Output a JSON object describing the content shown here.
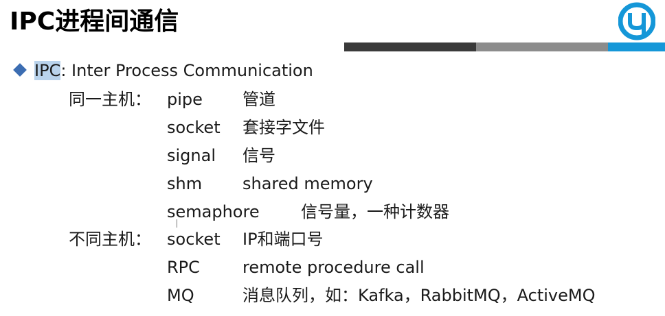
{
  "title": "IPC进程间通信",
  "heading": {
    "highlight": "IPC",
    "rest": ": Inter Process Communication"
  },
  "groups": [
    {
      "category": "同一主机：",
      "items": [
        {
          "term": "pipe",
          "desc": "管道"
        },
        {
          "term": "socket",
          "desc": "套接字文件"
        },
        {
          "term": "signal",
          "desc": "信号"
        },
        {
          "term": "shm",
          "desc": "shared memory"
        },
        {
          "term": "semaphore",
          "desc": "信号量，一种计数器"
        }
      ]
    },
    {
      "category": "不同主机：",
      "items": [
        {
          "term": "socket",
          "desc": "IP和端口号"
        },
        {
          "term": "RPC",
          "desc": "remote procedure call"
        },
        {
          "term": "MQ",
          "desc": "消息队列，如：Kafka，RabbitMQ，ActiveMQ"
        }
      ]
    }
  ],
  "colors": {
    "bar_dark": "#3a3a3a",
    "bar_gray": "#8c8c8c",
    "bar_blue": "#1597d8",
    "bullet": "#3c6db2",
    "highlight": "#b9d3ec"
  },
  "logo_icon": "brand-logo-icon"
}
